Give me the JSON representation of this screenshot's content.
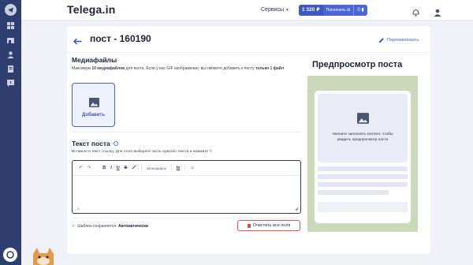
{
  "header": {
    "logo": "Telega.in",
    "services_label": "Сервисы",
    "balance_amount": "1 320 ₽",
    "topup_label": "Пополнить",
    "cart_count": "0"
  },
  "page": {
    "title": "пост - 160190",
    "rename_label": "Переименовать"
  },
  "media": {
    "title": "Медиафайлы",
    "hint_prefix": "Максимум ",
    "hint_bold1": "10 медиафайлов",
    "hint_middle": " для поста. Если у вас GIF изображение, вы сможете добавить к посту ",
    "hint_bold2": "только 1 файл",
    "add_label": "Добавить"
  },
  "text_section": {
    "title": "Текст поста",
    "hint": "Вставьте в текст ссылку. Для этого выберите часть нужного текста и нажмите",
    "toolbar": {
      "undo": "↶",
      "redo": "↷",
      "bold": "B",
      "italic": "I",
      "underline": "U",
      "strike": "S",
      "link": "🔗",
      "monospace": "Моноширок",
      "clear_format": "Ix",
      "emoji": "☺"
    },
    "editor_status": "p"
  },
  "footer": {
    "autosave_prefix": "Шаблон сохраняется ",
    "autosave_mode": "Автоматически",
    "clear_label": "Очистить все поля"
  },
  "preview": {
    "title": "Предпросмотр поста",
    "placeholder": "Начните заполнять контент, чтобы увидеть предпросмотр поста"
  },
  "colors": {
    "accent": "#4b66d4",
    "sidebar": "#2e3e6f",
    "danger": "#e05656",
    "preview_bg": "#cbd8b9"
  }
}
